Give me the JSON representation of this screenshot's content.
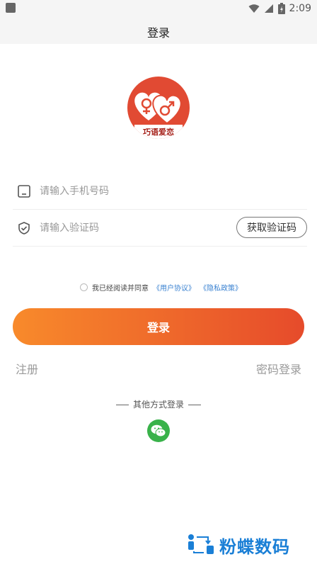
{
  "status": {
    "time": "2:09"
  },
  "title": "登录",
  "logo": {
    "text": "巧语爱恋"
  },
  "phone": {
    "placeholder": "请输入手机号码"
  },
  "code": {
    "placeholder": "请输入验证码",
    "button": "获取验证码"
  },
  "agreement": {
    "prefix": "我已经阅读并同意",
    "user_link": "《用户协议》",
    "privacy_link": "《隐私政策》"
  },
  "login_button": "登录",
  "register": "注册",
  "password_login": "密码登录",
  "other_login": "其他方式登录",
  "watermark": "粉蝶数码",
  "colors": {
    "accent_start": "#f88a2b",
    "accent_end": "#e64b2b",
    "wechat": "#39b24a",
    "link": "#3a82d1"
  }
}
